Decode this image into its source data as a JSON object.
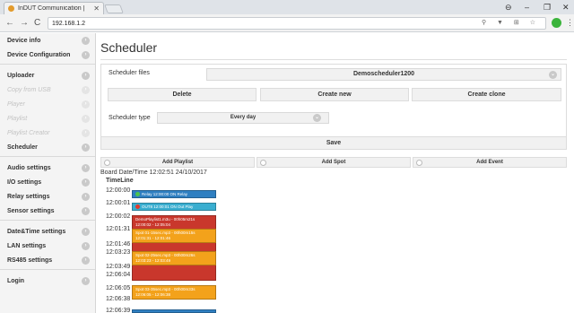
{
  "browser": {
    "tab_title": "InDUT Communication |",
    "tab_close": "✕",
    "url": "192.168.1.2",
    "minimize": "–",
    "maximize": "❐",
    "close": "✕",
    "back": "←",
    "forward": "→",
    "reload": "C"
  },
  "sidebar": {
    "groups": [
      [
        {
          "label": "Device info"
        },
        {
          "label": "Device Configuration"
        }
      ],
      [
        {
          "label": "Uploader"
        },
        {
          "label": "Copy from USB",
          "disabled": true
        },
        {
          "label": "Player",
          "disabled": true
        },
        {
          "label": "Playlist",
          "disabled": true
        },
        {
          "label": "Playlist Creator",
          "disabled": true
        },
        {
          "label": "Scheduler"
        }
      ],
      [
        {
          "label": "Audio settings"
        },
        {
          "label": "I/O settings"
        },
        {
          "label": "Relay settings"
        },
        {
          "label": "Sensor settings"
        }
      ],
      [
        {
          "label": "Date&Time settings"
        },
        {
          "label": "LAN settings"
        },
        {
          "label": "RS485 settings"
        }
      ],
      [
        {
          "label": "Login"
        }
      ]
    ]
  },
  "main": {
    "title": "Scheduler",
    "files_label": "Scheduler files",
    "selected_file": "Demoscheduler1200",
    "delete_label": "Delete",
    "create_new_label": "Create new",
    "create_clone_label": "Create clone",
    "type_label": "Scheduler type",
    "type_value": "Every day",
    "save_label": "Save",
    "add_playlist_label": "Add Playlist",
    "add_spot_label": "Add Spot",
    "add_event_label": "Add Event",
    "board_time": "Board Date/Time 12:02:51 24/10/2017",
    "timeline_label": "TimeLine"
  },
  "timeline": {
    "times": [
      "12:00:00",
      "12:00:01",
      "12:00:02",
      "12:01:31",
      "12:01:46",
      "12:03:23",
      "12:03:49",
      "12:06:04",
      "12:06:05",
      "12:06:38",
      "12:06:39"
    ],
    "events": [
      {
        "lines": [
          "Relay 12:00:00 ON Relay"
        ],
        "color": "#2f7fc1",
        "dot": "#4cc44c"
      },
      {
        "lines": [
          "OUT8 12:00:01 ON Out Play"
        ],
        "color": "#3aaed0",
        "dot": "#e23b2e"
      },
      {
        "lines": [
          "DemoPlaylist1.m3u - 00h05m21s",
          "12:00:02 - 12:05:04"
        ],
        "color": "#c9372c",
        "dot": ""
      },
      {
        "lines": [
          "Spot 01-15sec.mp3 - 00h00m15s",
          "12:01:31 - 12:01:46"
        ],
        "color": "#f3a21b",
        "dot": ""
      },
      {
        "lines": [
          "Spot 02-25sec.mp3 - 00h00m26s",
          "12:03:23 - 12:03:49"
        ],
        "color": "#f3a21b",
        "dot": ""
      },
      {
        "lines": [
          "Spot 03-35sec.mp3 - 00h00m33s",
          "12:06:05 - 12:06:38"
        ],
        "color": "#f3a21b",
        "dot": ""
      },
      {
        "lines": [
          ""
        ],
        "color": "#2f7fc1",
        "dot": ""
      }
    ]
  },
  "colors": {
    "playlist": "#c9372c",
    "spot": "#f3a21b",
    "relay": "#2f7fc1",
    "output": "#3aaed0"
  }
}
